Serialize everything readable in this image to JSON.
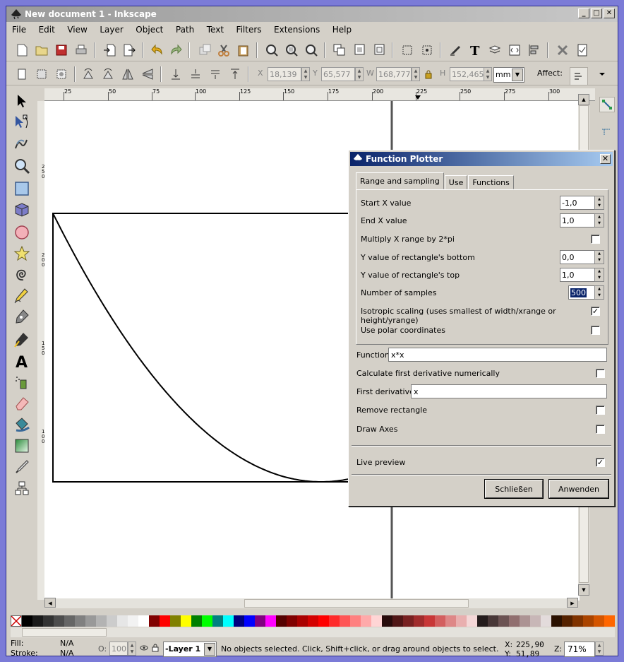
{
  "window": {
    "title": "New document 1 - Inkscape",
    "minimize": "_",
    "maximize": "□",
    "close": "✕"
  },
  "menu": [
    "File",
    "Edit",
    "View",
    "Layer",
    "Object",
    "Path",
    "Text",
    "Filters",
    "Extensions",
    "Help"
  ],
  "toolbar2": {
    "x_label": "X",
    "x_value": "18,139",
    "y_label": "Y",
    "y_value": "65,577",
    "w_label": "W",
    "w_value": "168,777",
    "h_label": "H",
    "h_value": "152,465",
    "unit": "mm",
    "affect_label": "Affect:"
  },
  "ruler": {
    "h_labels": [
      "25",
      "50",
      "75",
      "100",
      "125",
      "150",
      "175",
      "200",
      "225",
      "250",
      "275",
      "300"
    ],
    "v_labels": [
      "250",
      "200",
      "150",
      "100"
    ]
  },
  "dialog": {
    "title": "Function Plotter",
    "close": "✕",
    "tabs": [
      "Range and sampling",
      "Use",
      "Functions"
    ],
    "fields": {
      "start_x_label": "Start X value",
      "start_x_value": "-1,0",
      "end_x_label": "End X value",
      "end_x_value": "1,0",
      "multiply_label": "Multiply X range by 2*pi",
      "multiply_checked": false,
      "y_bottom_label": "Y value of rectangle's bottom",
      "y_bottom_value": "0,0",
      "y_top_label": "Y value of rectangle's top",
      "y_top_value": "1,0",
      "samples_label": "Number of samples",
      "samples_value": "500",
      "isotropic_label": "Isotropic scaling (uses smallest of width/xrange or height/yrange)",
      "isotropic_checked": true,
      "polar_label": "Use polar coordinates",
      "polar_checked": false,
      "function_label": "Function",
      "function_value": "x*x",
      "calc_deriv_label": "Calculate first derivative numerically",
      "calc_deriv_checked": false,
      "first_deriv_label": "First derivative",
      "first_deriv_value": "x",
      "remove_rect_label": "Remove rectangle",
      "remove_rect_checked": false,
      "draw_axes_label": "Draw Axes",
      "draw_axes_checked": false,
      "live_preview_label": "Live preview",
      "live_preview_checked": true
    },
    "buttons": {
      "close": "Schließen",
      "apply": "Anwenden"
    }
  },
  "status": {
    "fill_label": "Fill:",
    "fill_value": "N/A",
    "stroke_label": "Stroke:",
    "stroke_value": "N/A",
    "opacity_label": "O:",
    "opacity_value": "100",
    "layer": "-Layer 1",
    "message": "No objects selected. Click, Shift+click, or drag around objects to select.",
    "x_label": "X:",
    "x_value": "225,90",
    "y_label": "Y:",
    "y_value": "51,89",
    "zoom_label": "Z:",
    "zoom_value": "71%"
  },
  "plot": {
    "function": "x*x",
    "x_range": [
      -1,
      1
    ],
    "y_range": [
      0,
      1
    ],
    "samples": 500
  },
  "palette_colors": [
    "#000000",
    "#1a1a1a",
    "#333333",
    "#4d4d4d",
    "#666666",
    "#808080",
    "#999999",
    "#b3b3b3",
    "#cccccc",
    "#e6e6e6",
    "#f2f2f2",
    "#ffffff",
    "#800000",
    "#ff0000",
    "#808000",
    "#ffff00",
    "#008000",
    "#00ff00",
    "#008080",
    "#00ffff",
    "#000080",
    "#0000ff",
    "#800080",
    "#ff00ff",
    "#550000",
    "#800000",
    "#aa0000",
    "#d40000",
    "#ff0000",
    "#ff2a2a",
    "#ff5555",
    "#ff8080",
    "#ffaaaa",
    "#ffd5d5",
    "#280b0b",
    "#501616",
    "#782121",
    "#a02c2c",
    "#c83737",
    "#d35f5f",
    "#de8787",
    "#e9afaf",
    "#f4d7d7",
    "#241c1c",
    "#483737",
    "#6c5353",
    "#916f6f",
    "#ac9393",
    "#c8b7b7",
    "#e3dbdb",
    "#2b1100",
    "#552200",
    "#803300",
    "#aa4400",
    "#d45500",
    "#ff6600"
  ]
}
